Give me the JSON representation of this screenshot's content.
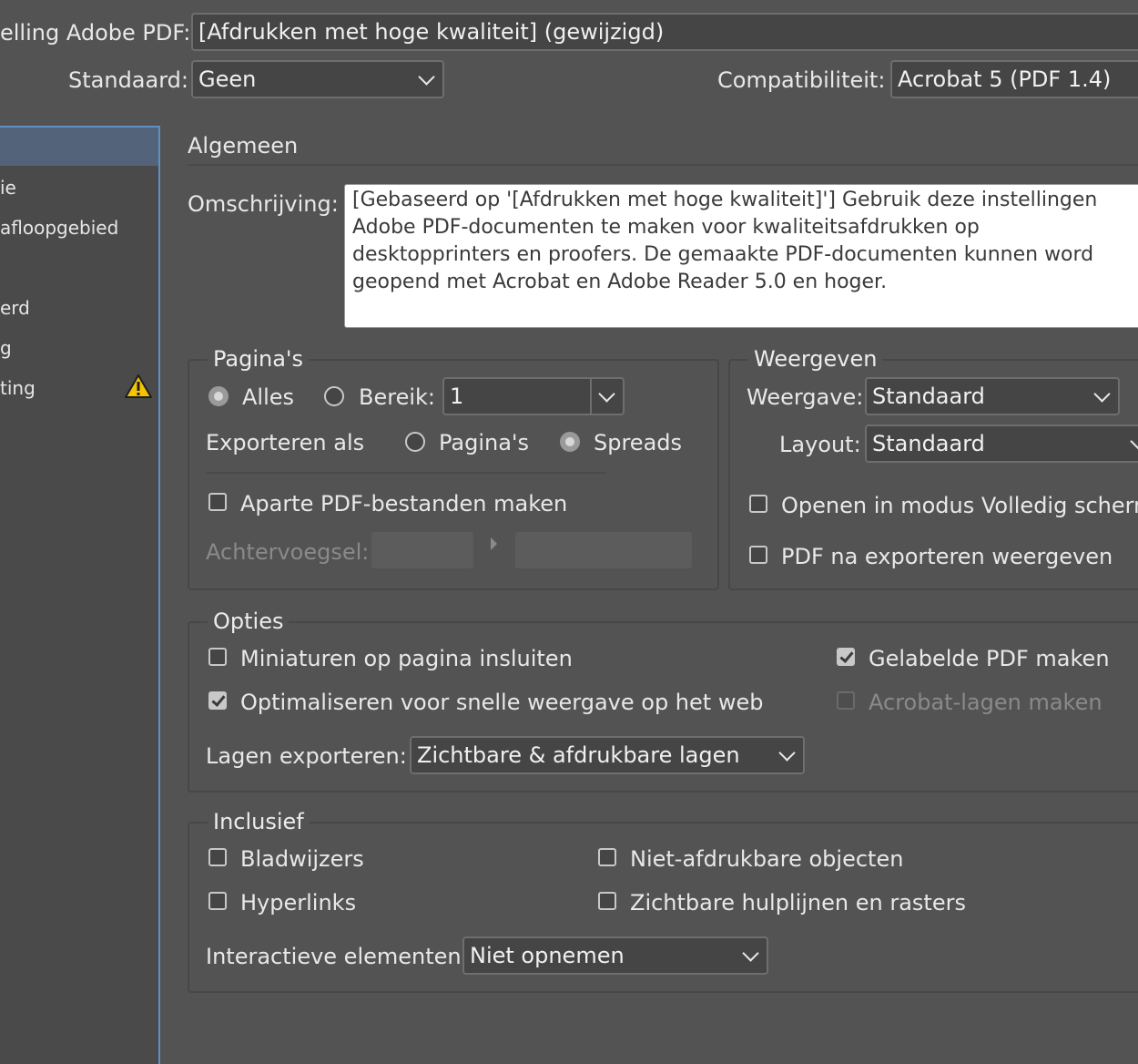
{
  "header": {
    "preset_label": "elling Adobe PDF:",
    "preset_value": "[Afdrukken met hoge kwaliteit] (gewijzigd)",
    "standard_label": "Standaard:",
    "standard_value": "Geen",
    "compat_label": "Compatibiliteit:",
    "compat_value": "Acrobat 5 (PDF 1.4)"
  },
  "sidebar": {
    "items": [
      {
        "label": ""
      },
      {
        "label": "ie"
      },
      {
        "label": " afloopgebied"
      },
      {
        "label": "erd"
      },
      {
        "label": "g"
      },
      {
        "label": "ting"
      }
    ]
  },
  "main": {
    "section_title": "Algemeen",
    "description_label": "Omschrijving:",
    "description_text": "[Gebaseerd op '[Afdrukken met hoge kwaliteit]'] Gebruik deze instellingen\nAdobe PDF-documenten te maken voor kwaliteitsafdrukken op\ndesktopprinters en proofers. De gemaakte PDF-documenten kunnen word\ngeopend met Acrobat en Adobe Reader 5.0 en hoger."
  },
  "pages": {
    "title": "Pagina's",
    "all_label": "Alles",
    "range_label": "Bereik:",
    "range_value": "1",
    "export_as_label": "Exporteren als",
    "pages_option": "Pagina's",
    "spreads_option": "Spreads",
    "separate_label": "Aparte PDF-bestanden maken",
    "suffix_label": "Achtervoegsel:"
  },
  "view": {
    "title": "Weergeven",
    "view_label": "Weergave:",
    "view_value": "Standaard",
    "layout_label": "Layout:",
    "layout_value": "Standaard",
    "fullscreen_label": "Openen in modus Volledig scherm",
    "view_after_label": "PDF na exporteren weergeven"
  },
  "options": {
    "title": "Opties",
    "thumbnails_label": "Miniaturen op pagina insluiten",
    "optimize_label": "Optimaliseren voor snelle weergave op het web",
    "tagged_label": "Gelabelde PDF maken",
    "acrobat_layers_label": "Acrobat-lagen maken",
    "export_layers_label": "Lagen exporteren:",
    "export_layers_value": "Zichtbare & afdrukbare lagen"
  },
  "include": {
    "title": "Inclusief",
    "bookmarks_label": "Bladwijzers",
    "hyperlinks_label": "Hyperlinks",
    "nonprint_label": "Niet-afdrukbare objecten",
    "guides_label": "Zichtbare hulplijnen en rasters",
    "interactive_label": "Interactieve elementen:",
    "interactive_value": "Niet opnemen"
  },
  "colors": {
    "background": "#535353",
    "accent": "#5f8fc4",
    "warning": "#f5c400"
  }
}
